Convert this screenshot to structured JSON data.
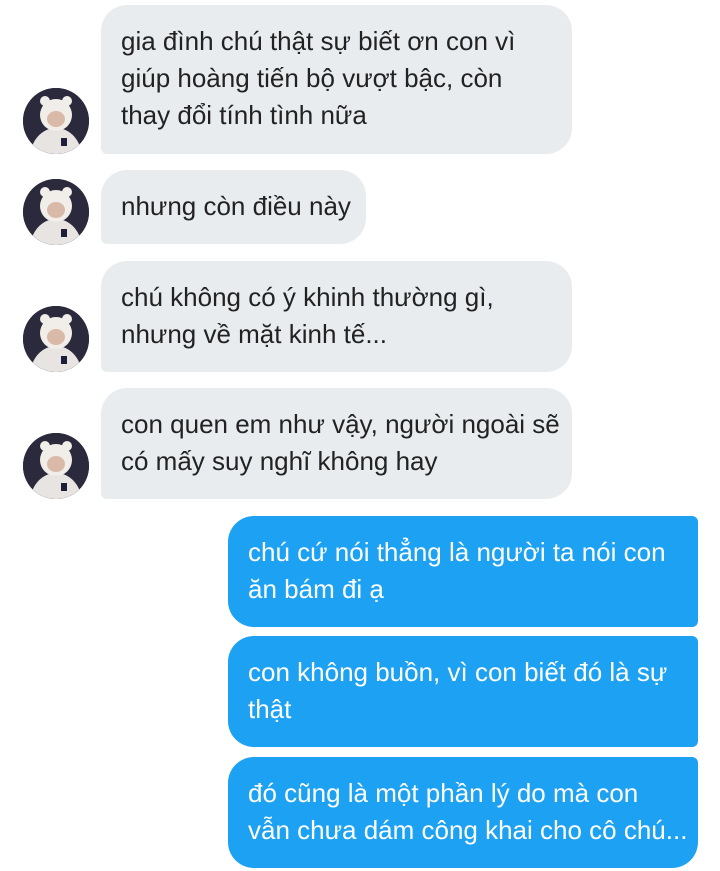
{
  "conversation": {
    "incoming": [
      {
        "lines": [
          "gia đình chú thật sự biết ơn con vì",
          "giúp hoàng tiến bộ vượt bậc, còn",
          "thay đổi tính tình nữa"
        ]
      },
      {
        "lines": [
          "nhưng còn điều này"
        ]
      },
      {
        "lines": [
          "chú không có ý khinh thường gì,",
          "nhưng về mặt kinh tế..."
        ]
      },
      {
        "lines": [
          "con quen em như vậy, người ngoài sẽ",
          "có mấy suy nghĩ không hay"
        ]
      }
    ],
    "outgoing": [
      {
        "lines": [
          "chú cứ nói thẳng là người ta nói con",
          "ăn bám đi ạ"
        ]
      },
      {
        "lines": [
          "con không buồn, vì con biết đó là sự",
          "thật"
        ]
      },
      {
        "lines": [
          "đó cũng là một phần lý do mà con",
          "vẫn chưa dám công khai cho cô chú..."
        ]
      }
    ]
  },
  "colors": {
    "incoming_bubble": "#e9ecef",
    "outgoing_bubble": "#1da1f2",
    "incoming_text": "#222222",
    "outgoing_text": "#ffffff"
  },
  "icons": {
    "avatar": "contact-avatar-photo"
  }
}
